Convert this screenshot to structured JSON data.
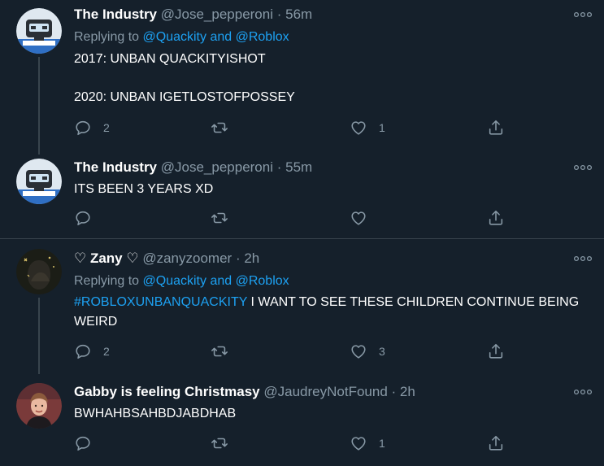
{
  "tweets": [
    {
      "name": "The Industry",
      "handle": "@Jose_pepperoni",
      "time": "56m",
      "replying_prefix": "Replying to",
      "reply_to_1": "@Quackity",
      "reply_and": "and",
      "reply_to_2": "@Roblox",
      "text_line_1": "2017: UNBAN QUACKITYISHOT",
      "text_line_2": "2020: UNBAN IGETLOSTOFPOSSEY",
      "reply_count": "2",
      "retweet_count": "",
      "like_count": "1"
    },
    {
      "name": "The Industry",
      "handle": "@Jose_pepperoni",
      "time": "55m",
      "text_line_1": "ITS BEEN 3 YEARS XD",
      "reply_count": "",
      "retweet_count": "",
      "like_count": ""
    },
    {
      "name": "♡ Zany ♡",
      "handle": "@zanyzoomer",
      "time": "2h",
      "replying_prefix": "Replying to",
      "reply_to_1": "@Quackity",
      "reply_and": "and",
      "reply_to_2": "@Roblox",
      "hashtag": "#ROBLOXUNBANQUACKITY",
      "text_rest": " I WANT TO SEE THESE CHILDREN CONTINUE BEING WEIRD",
      "reply_count": "2",
      "retweet_count": "",
      "like_count": "3"
    },
    {
      "name": "Gabby is feeling Christmasy",
      "handle": "@JaudreyNotFound",
      "time": "2h",
      "text_line_1": "BWHAHBSAHBDJABDHAB",
      "reply_count": "",
      "retweet_count": "",
      "like_count": "1"
    }
  ],
  "separator": "·",
  "colors": {
    "background": "#15202b",
    "muted": "#8899a6",
    "link": "#1da1f2",
    "divider": "#38444d"
  },
  "icons": {
    "reply": "reply-icon",
    "retweet": "retweet-icon",
    "like": "heart-icon",
    "share": "share-icon",
    "more": "more-icon"
  }
}
